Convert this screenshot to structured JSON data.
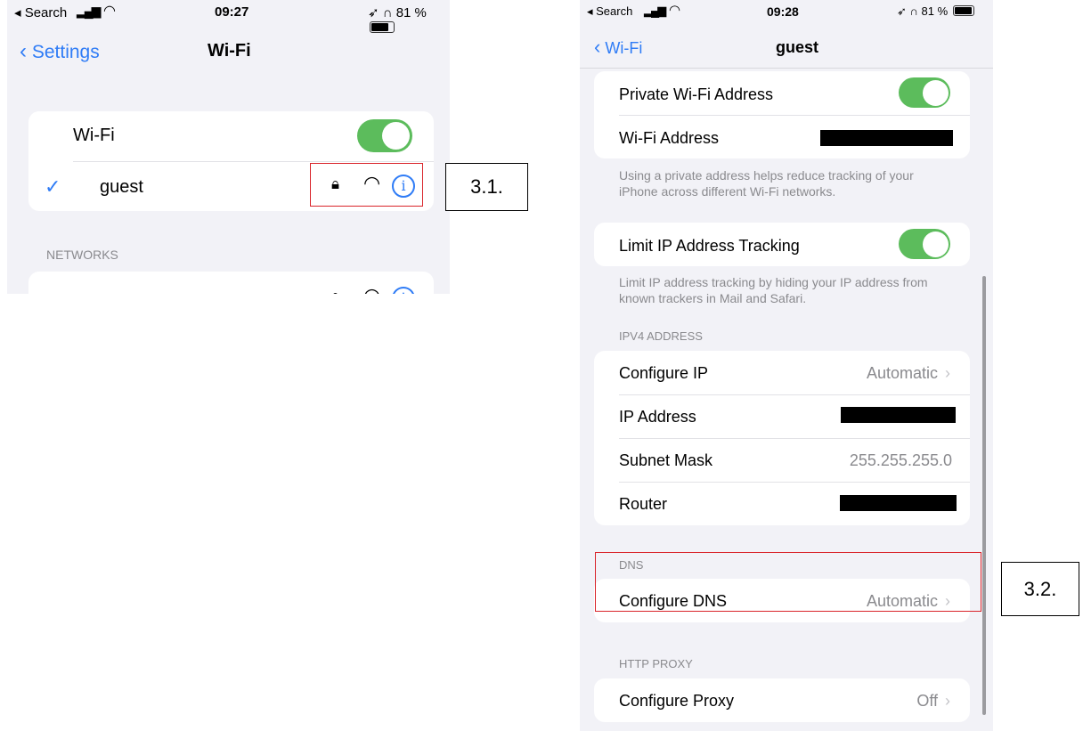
{
  "left": {
    "status": {
      "back": "◂ Search",
      "time": "09:27",
      "battery": "81 %"
    },
    "nav": {
      "back_label": "Settings",
      "title": "Wi-Fi"
    },
    "wifi_label": "Wi-Fi",
    "network": {
      "checkmark": "✓",
      "name": "guest"
    },
    "networks_header": "NETWORKS",
    "icons": [
      "lock-icon",
      "wifi-icon",
      "info-icon"
    ]
  },
  "right": {
    "status": {
      "back": "◂ Search",
      "time": "09:28",
      "battery": "81 %"
    },
    "nav": {
      "back_label": "Wi-Fi",
      "title": "guest"
    },
    "private_address": {
      "label": "Private Wi-Fi Address",
      "wifi_address_label": "Wi-Fi Address"
    },
    "private_footer": "Using a private address helps reduce tracking of your iPhone across different Wi-Fi networks.",
    "limit_ip": {
      "label": "Limit IP Address Tracking"
    },
    "limit_footer": "Limit IP address tracking by hiding your IP address from known trackers in Mail and Safari.",
    "ipv4": {
      "header": "IPV4 ADDRESS",
      "configure_ip": {
        "label": "Configure IP",
        "value": "Automatic"
      },
      "ip_address": {
        "label": "IP Address"
      },
      "subnet": {
        "label": "Subnet Mask",
        "value": "255.255.255.0"
      },
      "router": {
        "label": "Router"
      }
    },
    "dns": {
      "header": "DNS",
      "label": "Configure DNS",
      "value": "Automatic"
    },
    "proxy": {
      "header": "HTTP PROXY",
      "label": "Configure Proxy",
      "value": "Off"
    }
  },
  "annotations": {
    "step1": "3.1.",
    "step2": "3.2."
  },
  "colors": {
    "accent": "#2f7cf6",
    "toggle_on": "#5cbc5c",
    "highlight": "#d9242a"
  }
}
